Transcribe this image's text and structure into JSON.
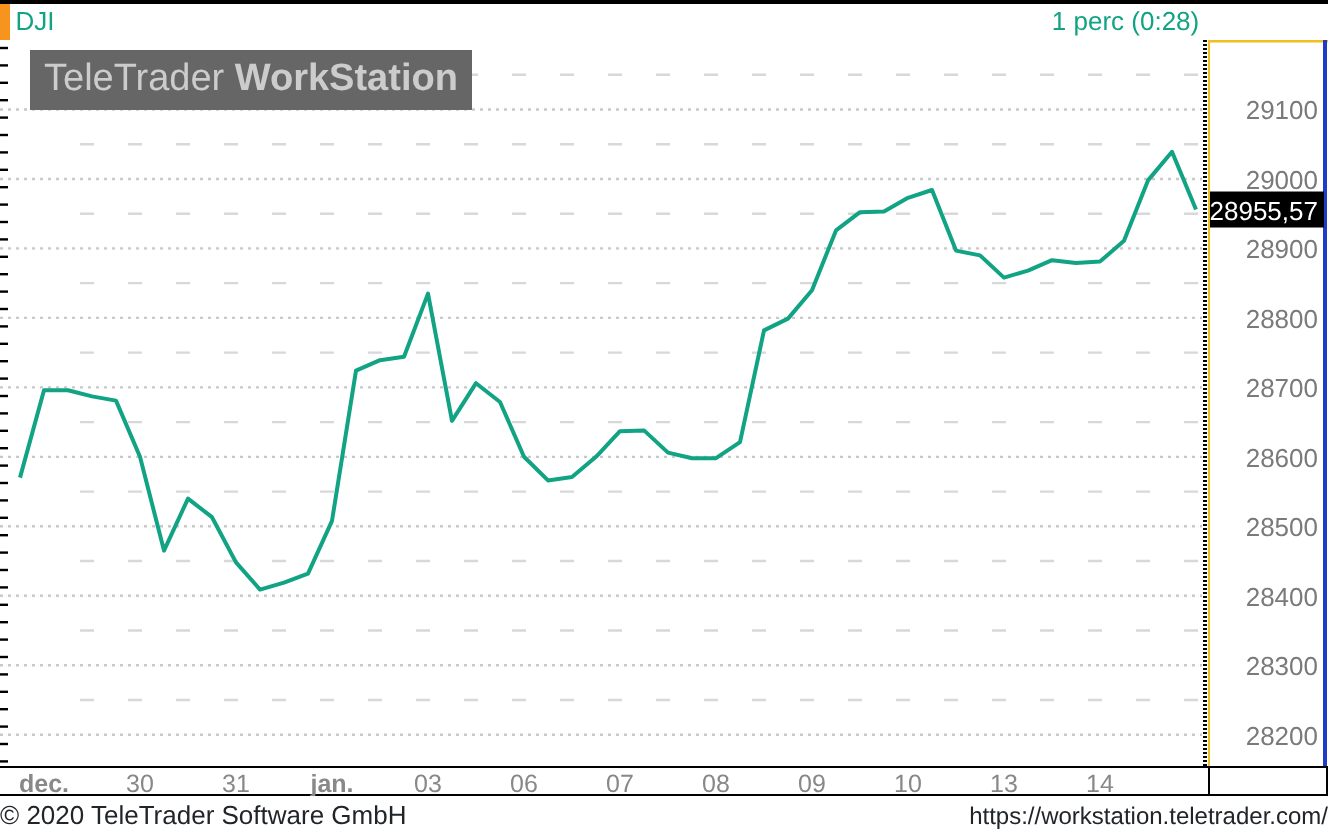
{
  "header": {
    "symbol": "DJI",
    "interval": "1 perc (0:28)"
  },
  "logo": "TeleTrader **WorkStation**",
  "last_price": "28955,57",
  "chart": {
    "chart_data": {
      "type": "line",
      "ylim": [
        28155,
        29200
      ],
      "categories": [
        null,
        "dec.",
        null,
        null,
        null,
        "30",
        null,
        null,
        null,
        "31",
        null,
        null,
        null,
        "jan.",
        null,
        null,
        null,
        "03",
        null,
        null,
        null,
        "06",
        null,
        null,
        null,
        "07",
        null,
        null,
        null,
        "08",
        null,
        null,
        null,
        "09",
        null,
        null,
        null,
        "10",
        null,
        null,
        null,
        "13",
        null,
        null,
        null,
        "14",
        null,
        null,
        null,
        null
      ],
      "series": [
        {
          "color": "#11a383",
          "values": [
            28570,
            28696,
            28696,
            28687,
            28681,
            28600,
            28465,
            28540,
            28513,
            28448,
            28409,
            28419,
            28432,
            28508,
            28724,
            28739,
            28744,
            28835,
            28652,
            28706,
            28679,
            28600,
            28566,
            28571,
            28600,
            28637,
            28638,
            28606,
            28598,
            28598,
            28621,
            28782,
            28799,
            28840,
            28926,
            28952,
            28953,
            28973,
            28984,
            28897,
            28890,
            28858,
            28868,
            28883,
            28879,
            28881,
            28911,
            28998,
            29039,
            28956
          ]
        }
      ],
      "grid": true,
      "yticks": [
        28200,
        28300,
        28400,
        28500,
        28600,
        28700,
        28800,
        28900,
        29000,
        29100
      ]
    },
    "x_label_styles": [
      {
        "bold": true
      },
      {
        "bold": false
      },
      {
        "bold": false
      },
      {
        "bold": true
      },
      {
        "bold": false
      },
      {
        "bold": false
      },
      {
        "bold": false
      },
      {
        "bold": false
      },
      {
        "bold": false
      },
      {
        "bold": false
      },
      {
        "bold": false
      },
      {
        "bold": false
      }
    ]
  },
  "footer": {
    "copyright": "© 2020 TeleTrader Software GmbH",
    "url": "https://workstation.teletrader.com/"
  }
}
